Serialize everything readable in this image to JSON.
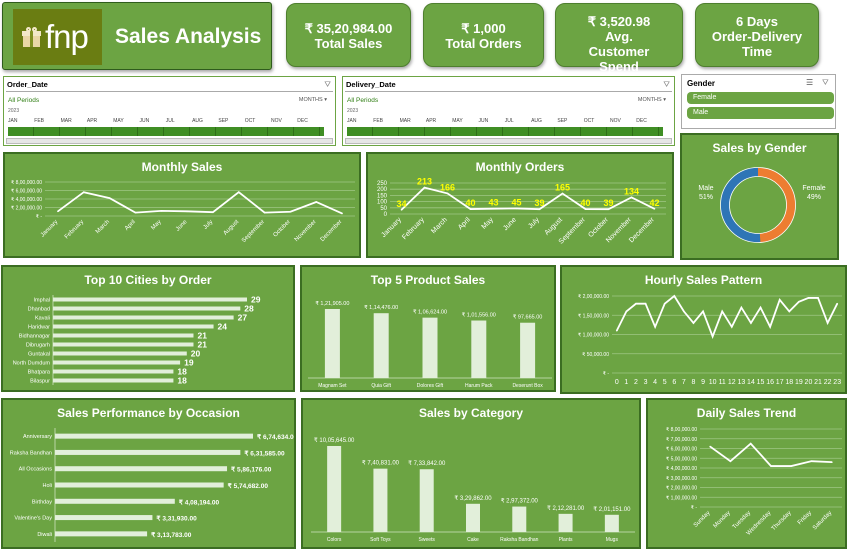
{
  "header": {
    "logo_text": "fnp",
    "title": "Sales Analysis"
  },
  "kpis": [
    {
      "value": "₹ 35,20,984.00",
      "label": "Total Sales"
    },
    {
      "value": "₹ 1,000",
      "label": "Total Orders"
    },
    {
      "value": "₹ 3,520.98",
      "label": "Avg. Customer Spend"
    },
    {
      "value": "6 Days",
      "label": "Order-Delivery Time"
    }
  ],
  "slicers": {
    "order_date": {
      "title": "Order_Date",
      "all": "All Periods",
      "unit": "MONTHS",
      "year": "2023",
      "months": [
        "JAN",
        "FEB",
        "MAR",
        "APR",
        "MAY",
        "JUN",
        "JUL",
        "AUG",
        "SEP",
        "OCT",
        "NOV",
        "DEC"
      ]
    },
    "delivery_date": {
      "title": "Delivery_Date",
      "all": "All Periods",
      "unit": "MONTHS",
      "year": "2023",
      "months": [
        "JAN",
        "FEB",
        "MAR",
        "APR",
        "MAY",
        "JUN",
        "JUL",
        "AUG",
        "SEP",
        "OCT",
        "NOV",
        "DEC"
      ]
    },
    "gender": {
      "title": "Gender",
      "options": [
        "Female",
        "Male"
      ]
    }
  },
  "colors": {
    "panel": "#6ca443",
    "female": "#ed7d31",
    "male": "#2e75b6",
    "bar": "#e2efda",
    "label_yellow": "#ffff00"
  },
  "chart_data": [
    {
      "id": "monthly_sales",
      "type": "line",
      "title": "Monthly Sales",
      "categories": [
        "January",
        "February",
        "March",
        "April",
        "May",
        "June",
        "July",
        "August",
        "September",
        "October",
        "November",
        "December"
      ],
      "values": [
        110000,
        560000,
        420000,
        80000,
        120000,
        110000,
        90000,
        560000,
        80000,
        100000,
        330000,
        60000
      ],
      "yticks": [
        "₹ -",
        "₹ 2,00,000.00",
        "₹ 4,00,000.00",
        "₹ 6,00,000.00",
        "₹ 8,00,000.00"
      ],
      "ylim": [
        0,
        800000
      ]
    },
    {
      "id": "monthly_orders",
      "type": "line",
      "title": "Monthly Orders",
      "categories": [
        "January",
        "February",
        "March",
        "April",
        "May",
        "June",
        "July",
        "August",
        "September",
        "October",
        "November",
        "December"
      ],
      "values": [
        34,
        213,
        166,
        40,
        43,
        45,
        39,
        165,
        40,
        39,
        134,
        42
      ],
      "data_labels": [
        "34",
        "213",
        "166",
        "40",
        "43",
        "45",
        "39",
        "165",
        "40",
        "39",
        "134",
        "42"
      ],
      "yticks": [
        "0",
        "50",
        "100",
        "150",
        "200",
        "250"
      ],
      "ylim": [
        0,
        250
      ]
    },
    {
      "id": "sales_by_gender",
      "type": "pie",
      "title": "Sales by Gender",
      "labels": [
        "Male",
        "Female"
      ],
      "values": [
        51,
        49
      ],
      "pct_labels": [
        "51%",
        "49%"
      ]
    },
    {
      "id": "top_cities",
      "type": "bar",
      "title": "Top 10 Cities by Order",
      "categories": [
        "Imphal",
        "Dhanbad",
        "Kavali",
        "Haridwar",
        "Bidhannagar",
        "Dibrugarh",
        "Guntakal",
        "North Dumdum",
        "Bhatpara",
        "Bilaspur"
      ],
      "values": [
        29,
        28,
        27,
        24,
        21,
        21,
        20,
        19,
        18,
        18
      ],
      "data_labels": [
        "29",
        "28",
        "27",
        "24",
        "21",
        "21",
        "20",
        "19",
        "18",
        "18"
      ]
    },
    {
      "id": "top_products",
      "type": "bar",
      "title": "Top 5 Product Sales",
      "categories": [
        "Magnam Set",
        "Quia Gift",
        "Dolores Gift",
        "Harum Pack",
        "Deserunt Box"
      ],
      "values": [
        121905,
        114476,
        106624,
        101556,
        97665
      ],
      "data_labels": [
        "₹ 1,21,905.00",
        "₹ 1,14,476.00",
        "₹ 1,06,624.00",
        "₹ 1,01,556.00",
        "₹ 97,665.00"
      ]
    },
    {
      "id": "hourly_sales",
      "type": "line",
      "title": "Hourly Sales Pattern",
      "categories": [
        "0",
        "1",
        "2",
        "3",
        "4",
        "5",
        "6",
        "7",
        "8",
        "9",
        "10",
        "11",
        "12",
        "13",
        "14",
        "15",
        "16",
        "17",
        "18",
        "19",
        "20",
        "21",
        "22",
        "23"
      ],
      "values": [
        110000,
        160000,
        180000,
        180000,
        120000,
        180000,
        200000,
        160000,
        130000,
        160000,
        95000,
        160000,
        120000,
        170000,
        130000,
        170000,
        120000,
        190000,
        160000,
        185000,
        195000,
        195000,
        130000,
        180000
      ],
      "yticks": [
        "₹ -",
        "₹ 50,000.00",
        "₹ 1,00,000.00",
        "₹ 1,50,000.00",
        "₹ 2,00,000.00"
      ],
      "ylim": [
        0,
        200000
      ]
    },
    {
      "id": "occasion_sales",
      "type": "bar",
      "title": "Sales Performance by Occasion",
      "categories": [
        "Anniversary",
        "Raksha Bandhan",
        "All Occasions",
        "Holi",
        "Birthday",
        "Valentine's Day",
        "Diwali"
      ],
      "values": [
        674634,
        631585,
        586176,
        574682,
        408194,
        331930,
        313783
      ],
      "data_labels": [
        "₹ 6,74,634.00",
        "₹ 6,31,585.00",
        "₹ 5,86,176.00",
        "₹ 5,74,682.00",
        "₹ 4,08,194.00",
        "₹ 3,31,930.00",
        "₹ 3,13,783.00"
      ]
    },
    {
      "id": "category_sales",
      "type": "bar",
      "title": "Sales by Category",
      "categories": [
        "Colors",
        "Soft Toys",
        "Sweets",
        "Cake",
        "Raksha Bandhan",
        "Plants",
        "Mugs"
      ],
      "values": [
        1005645,
        740831,
        733842,
        329862,
        297372,
        212281,
        201151
      ],
      "data_labels": [
        "₹ 10,05,645.00",
        "₹ 7,40,831.00",
        "₹ 7,33,842.00",
        "₹ 3,29,862.00",
        "₹ 2,97,372.00",
        "₹ 2,12,281.00",
        "₹ 2,01,151.00"
      ]
    },
    {
      "id": "daily_sales",
      "type": "line",
      "title": "Daily Sales Trend",
      "categories": [
        "Sunday",
        "Monday",
        "Tuesday",
        "Wednesday",
        "Thursday",
        "Friday",
        "Saturday"
      ],
      "values": [
        620000,
        470000,
        650000,
        420000,
        420000,
        470000,
        460000
      ],
      "yticks": [
        "₹ -",
        "₹ 1,00,000.00",
        "₹ 2,00,000.00",
        "₹ 3,00,000.00",
        "₹ 4,00,000.00",
        "₹ 5,00,000.00",
        "₹ 6,00,000.00",
        "₹ 7,00,000.00",
        "₹ 8,00,000.00"
      ],
      "ylim": [
        0,
        800000
      ]
    }
  ]
}
